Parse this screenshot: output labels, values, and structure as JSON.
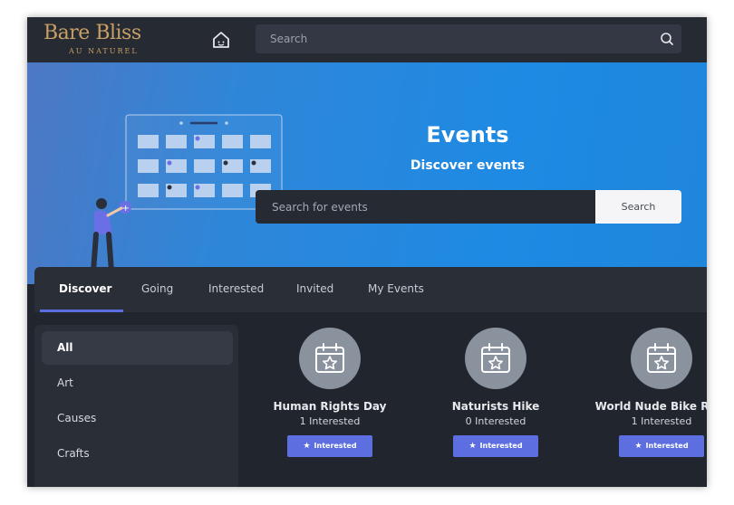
{
  "brand": {
    "name": "Bare Bliss",
    "tagline": "AU NATUREL",
    "color": "#c8a064"
  },
  "header": {
    "search_placeholder": "Search"
  },
  "hero": {
    "title": "Events",
    "subtitle": "Discover events",
    "search_placeholder": "Search for events",
    "search_button": "Search"
  },
  "tabs": [
    {
      "label": "Discover",
      "active": true
    },
    {
      "label": "Going"
    },
    {
      "label": "Interested"
    },
    {
      "label": "Invited"
    },
    {
      "label": "My Events"
    }
  ],
  "categories": [
    {
      "label": "All",
      "active": true
    },
    {
      "label": "Art"
    },
    {
      "label": "Causes"
    },
    {
      "label": "Crafts"
    }
  ],
  "events": [
    {
      "title": "Human Rights Day",
      "interested": "1 Interested",
      "button": "Interested"
    },
    {
      "title": "Naturists Hike",
      "interested": "0 Interested",
      "button": "Interested"
    },
    {
      "title": "World Nude Bike Ride",
      "interested": "1 Interested",
      "button": "Interested"
    }
  ],
  "colors": {
    "accent": "#5d6fe0",
    "hero": "#1e8ae3",
    "background": "#21252d"
  }
}
